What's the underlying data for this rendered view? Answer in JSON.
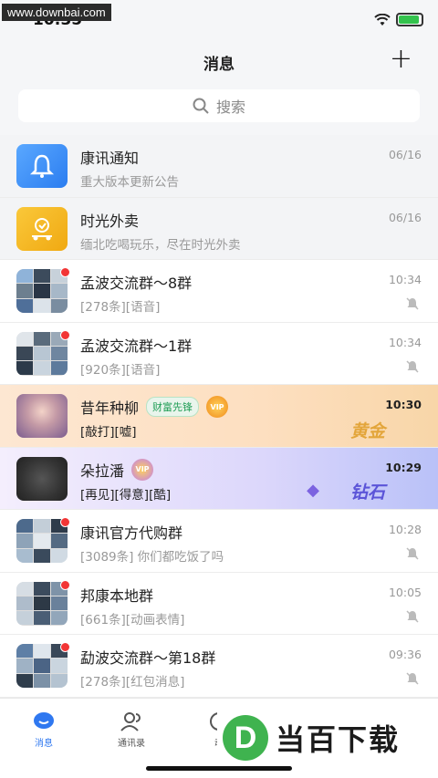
{
  "watermark_top": "www.downbai.com",
  "status": {
    "time": "10:35"
  },
  "header": {
    "title": "消息",
    "add": "+"
  },
  "search": {
    "placeholder": "搜索"
  },
  "chats": [
    {
      "name": "康讯通知",
      "preview": "重大版本更新公告",
      "time": "06/16"
    },
    {
      "name": "时光外卖",
      "preview": "缅北吃喝玩乐，尽在时光外卖",
      "time": "06/16"
    },
    {
      "name": "孟波交流群～8群",
      "preview": "[278条][语音]",
      "time": "10:34"
    },
    {
      "name": "孟波交流群～1群",
      "preview": "[920条][语音]",
      "time": "10:34"
    },
    {
      "name": "昔年种柳",
      "preview": "[敲打][嘘]",
      "time": "10:30",
      "badge_label": "财富先锋",
      "tier": "黄金"
    },
    {
      "name": "朵拉潘",
      "preview": "[再见][得意][酷]",
      "time": "10:29",
      "tier": "钻石"
    },
    {
      "name": "康讯官方代购群",
      "preview": "[3089条] 你们都吃饭了吗",
      "time": "10:28"
    },
    {
      "name": "邦康本地群",
      "preview": "[661条][动画表情]",
      "time": "10:05"
    },
    {
      "name": "勐波交流群～第18群",
      "preview": "[278条][红包消息]",
      "time": "09:36"
    }
  ],
  "tabs": [
    {
      "label": "消息"
    },
    {
      "label": "通讯录"
    },
    {
      "label": "动"
    }
  ],
  "watermark_br": {
    "logo": "D",
    "text": "当百下载"
  },
  "colors": {
    "accent": "#2f78f0",
    "unread": "#f23535"
  }
}
